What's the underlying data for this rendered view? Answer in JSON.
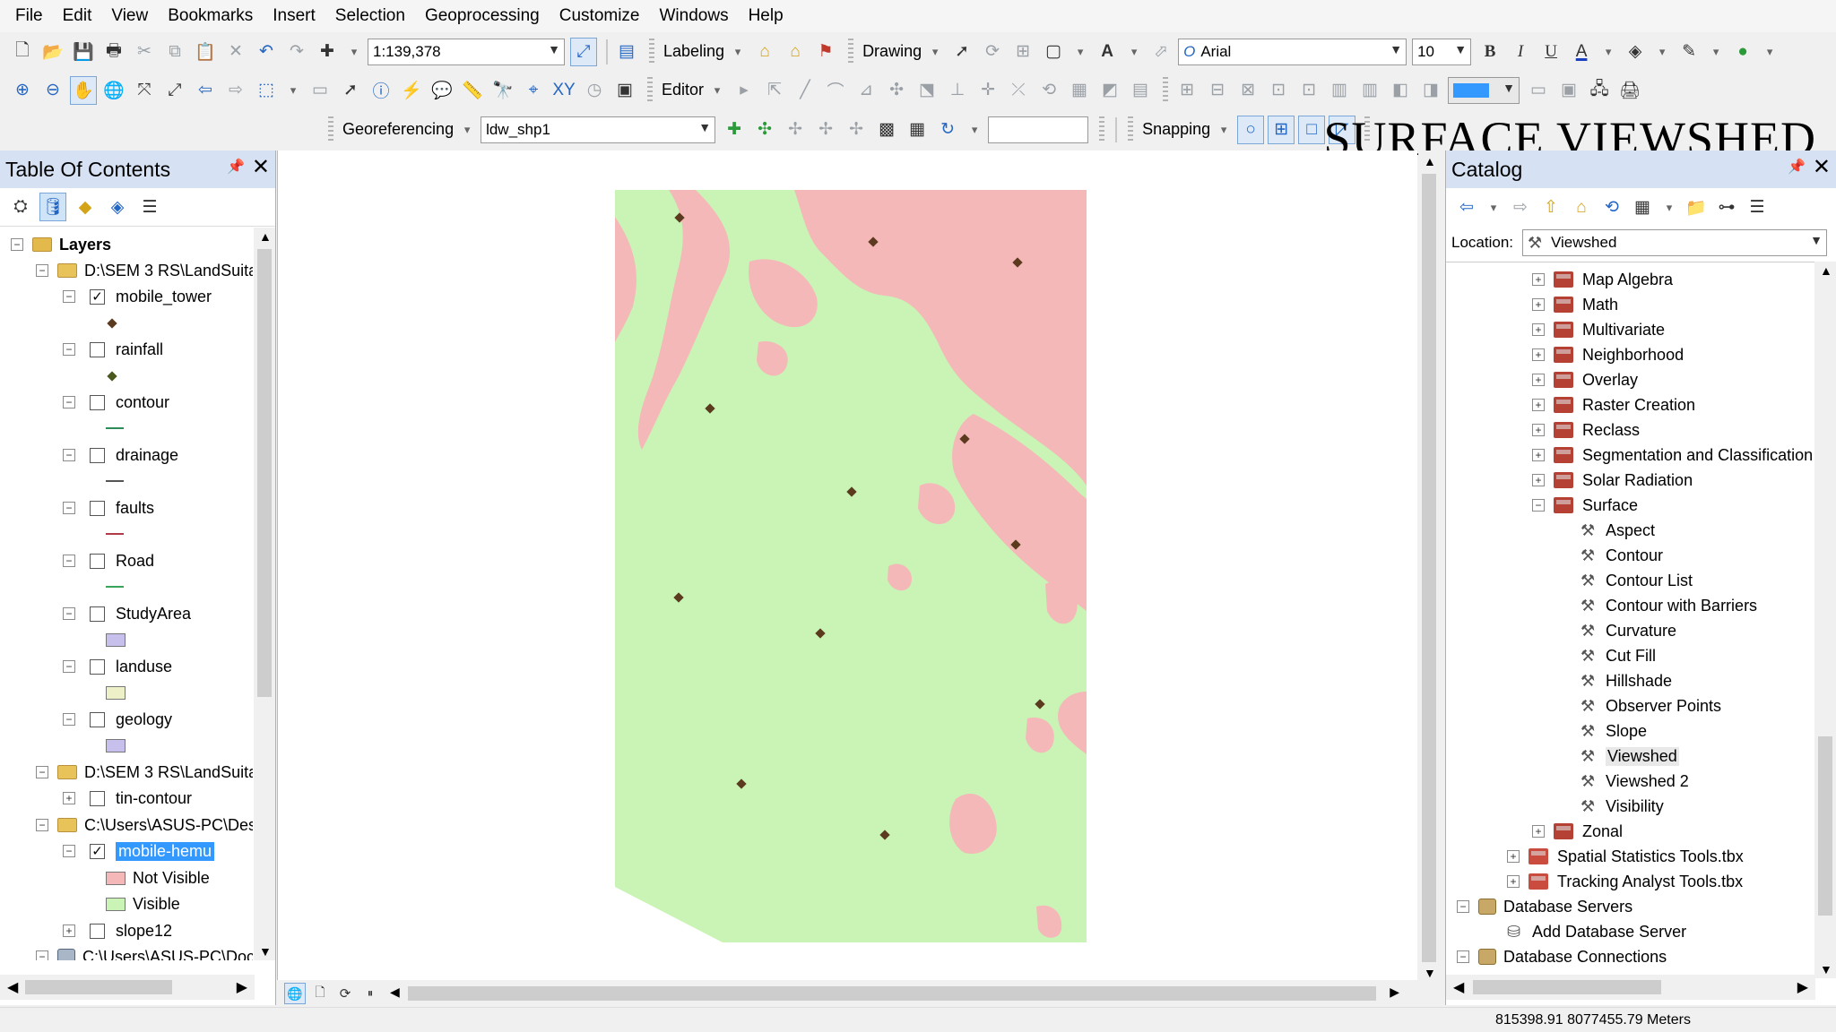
{
  "banner": "SURFACE VIEWSHED",
  "menu": [
    "File",
    "Edit",
    "View",
    "Bookmarks",
    "Insert",
    "Selection",
    "Geoprocessing",
    "Customize",
    "Windows",
    "Help"
  ],
  "toolbar": {
    "scale": "1:139,378",
    "labeling": "Labeling",
    "drawing": "Drawing",
    "font_name": "Arial",
    "font_size": "10",
    "editor": "Editor",
    "georeferencing": "Georeferencing",
    "georef_layer": "ldw_shp1",
    "snapping": "Snapping"
  },
  "toc": {
    "title": "Table Of Contents",
    "root": "Layers",
    "group1": "D:\\SEM 3 RS\\LandSuita",
    "group2": "D:\\SEM 3 RS\\LandSuita",
    "group3": "C:\\Users\\ASUS-PC\\Des",
    "group4": "C:\\Users\\ASUS-PC\\Doc",
    "layers": {
      "mobile_tower": "mobile_tower",
      "rainfall": "rainfall",
      "contour": "contour",
      "drainage": "drainage",
      "faults": "faults",
      "road": "Road",
      "studyarea": "StudyArea",
      "landuse": "landuse",
      "geology": "geology",
      "tin_contour": "tin-contour",
      "mobile_hemu": "mobile-hemu",
      "not_visible": "Not Visible",
      "visible": "Visible",
      "slope12": "slope12"
    },
    "colors": {
      "not_visible": "#f4b8b8",
      "visible": "#c9f4b5",
      "studyarea": "#c8c0ec",
      "landuse": "#eef0c8",
      "geology": "#c8c0ec",
      "contour": "#2e8b57",
      "drainage": "#555555",
      "faults": "#b03a4a",
      "road": "#3aa35a"
    }
  },
  "map": {
    "visible_color": "#c9f4b5",
    "not_visible_color": "#f4b8b8",
    "tower_color": "#5b3a1e"
  },
  "catalog": {
    "title": "Catalog",
    "location_label": "Location:",
    "location_value": "Viewshed",
    "toolsets": [
      "Map Algebra",
      "Math",
      "Multivariate",
      "Neighborhood",
      "Overlay",
      "Raster Creation",
      "Reclass",
      "Segmentation and Classification",
      "Solar Radiation",
      "Surface"
    ],
    "surface_tools": [
      "Aspect",
      "Contour",
      "Contour List",
      "Contour with Barriers",
      "Curvature",
      "Cut Fill",
      "Hillshade",
      "Observer Points",
      "Slope",
      "Viewshed",
      "Viewshed 2",
      "Visibility"
    ],
    "zonal": "Zonal",
    "spatial_stats": "Spatial Statistics Tools.tbx",
    "tracking": "Tracking Analyst Tools.tbx",
    "db_servers": "Database Servers",
    "add_db_server": "Add Database Server",
    "db_connections": "Database Connections"
  },
  "status": {
    "coords": "815398.91  8077455.79 Meters"
  }
}
